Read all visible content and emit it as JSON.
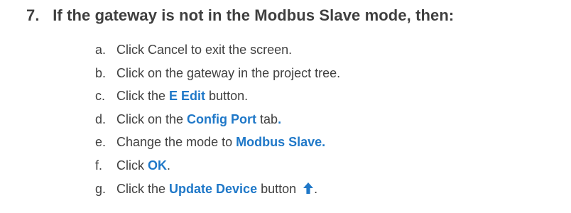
{
  "step": {
    "number": "7.",
    "heading": "If the gateway is not in the Modbus Slave mode, then:"
  },
  "substeps": {
    "a": {
      "letter": "a.",
      "text": "Click Cancel to exit the screen."
    },
    "b": {
      "letter": "b.",
      "text": "Click on the gateway in the project tree."
    },
    "c": {
      "letter": "c.",
      "pre": "Click the ",
      "highlight": "E Edit",
      "post": " button."
    },
    "d": {
      "letter": "d.",
      "pre": "Click on the ",
      "highlight": "Config Port",
      "mid": " tab",
      "highlight_period": "."
    },
    "e": {
      "letter": "e.",
      "pre": "Change the mode to ",
      "highlight": "Modbus Slave."
    },
    "f": {
      "letter": "f.",
      "pre": "Click ",
      "highlight": "OK",
      "post": "."
    },
    "g": {
      "letter": "g.",
      "pre": "Click the ",
      "highlight": "Update Device",
      "post": " button ",
      "icon": "up-arrow-icon",
      "end": "."
    }
  },
  "colors": {
    "highlight": "#1f78c8",
    "body_text": "#404040"
  }
}
